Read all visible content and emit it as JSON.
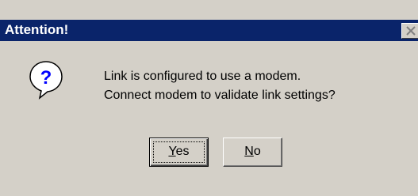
{
  "window": {
    "title": "Attention!"
  },
  "message": {
    "line1": "Link is configured to use a modem.",
    "line2": "Connect modem to validate link settings?"
  },
  "buttons": {
    "yes": {
      "mnemonic": "Y",
      "rest": "es"
    },
    "no": {
      "mnemonic": "N",
      "rest": "o"
    }
  },
  "icons": {
    "message_icon": "question-icon",
    "close": "close-icon"
  },
  "colors": {
    "titlebar": "#0a246a",
    "title_text": "#ffffff",
    "face": "#d4d0c8",
    "icon_blue": "#0000ff"
  }
}
